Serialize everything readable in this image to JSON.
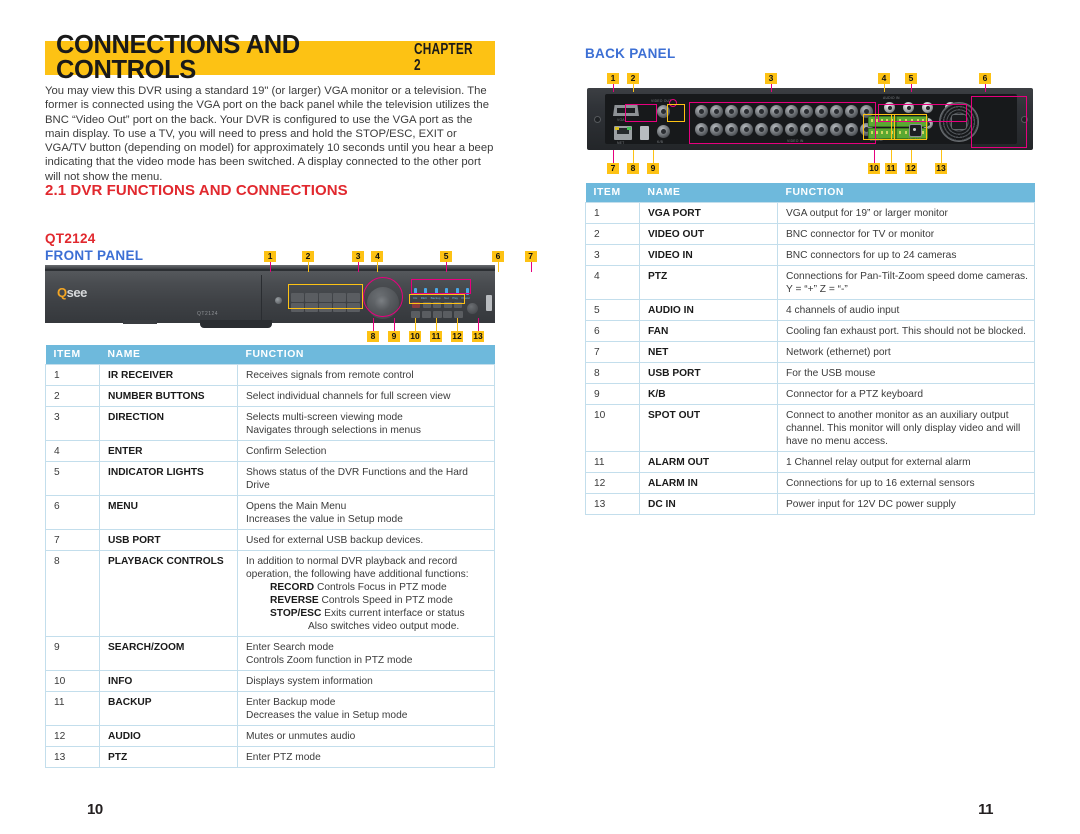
{
  "banner": {
    "title": "CONNECTIONS AND CONTROLS",
    "chapter": "CHAPTER 2"
  },
  "intro": {
    "paragraph": "You may view this DVR using a standard 19\" (or larger) VGA monitor or a television. The former is connected using the VGA port on the back panel while the television utilizes the BNC “Video Out” port on the back. Your DVR is configured to use the VGA port as the main display. To use a TV, you will need to press and hold the STOP/ESC, EXIT or VGA/TV button (depending on model) for approximately 10 seconds until you hear a beep indicating that the video mode has been switched. A display connected to the other port will not show the menu."
  },
  "headings": {
    "section": "2.1 DVR FUNCTIONS AND CONNECTIONS",
    "model": "QT2124",
    "front_panel": "FRONT PANEL",
    "back_panel": "BACK PANEL"
  },
  "device": {
    "front_logo_q": "Q",
    "front_logo_rest": "see",
    "front_model_label": "QT2124",
    "led_labels": [
      "CH",
      "REC",
      "Backup",
      "Net",
      "Play",
      "Power"
    ],
    "back_labels": {
      "video_out": "VIDEO OUT",
      "video_in": "VIDEO IN",
      "audio_in": "AUDIO IN",
      "net": "NET",
      "kb": "K/B",
      "alarm": "ALARM",
      "dc": "DC 12V"
    }
  },
  "callouts": {
    "front_top": [
      "1",
      "2",
      "3",
      "4",
      "5",
      "6",
      "7"
    ],
    "front_bottom": [
      "8",
      "9",
      "10",
      "11",
      "12",
      "13"
    ],
    "back_top": [
      "1",
      "2",
      "3",
      "4",
      "5",
      "6"
    ],
    "back_bottom": [
      "7",
      "8",
      "9",
      "10",
      "11",
      "12",
      "13"
    ]
  },
  "table_headers": {
    "item": "ITEM",
    "name": "NAME",
    "function": "FUNCTION"
  },
  "front_panel_table": [
    {
      "item": "1",
      "name": "IR RECEIVER",
      "lines": [
        {
          "t": "Receives signals from remote control"
        }
      ]
    },
    {
      "item": "2",
      "name": "NUMBER BUTTONS",
      "lines": [
        {
          "t": "Select individual channels for full screen view"
        }
      ]
    },
    {
      "item": "3",
      "name": "DIRECTION",
      "lines": [
        {
          "t": "Selects multi-screen viewing mode"
        },
        {
          "t": "Navigates through selections in menus"
        }
      ]
    },
    {
      "item": "4",
      "name": "ENTER",
      "lines": [
        {
          "t": "Confirm Selection"
        }
      ]
    },
    {
      "item": "5",
      "name": "INDICATOR LIGHTS",
      "lines": [
        {
          "t": "Shows status of the DVR Functions and the Hard Drive"
        }
      ]
    },
    {
      "item": "6",
      "name": "MENU",
      "lines": [
        {
          "t": "Opens the Main Menu"
        },
        {
          "t": "Increases the value in Setup mode"
        }
      ]
    },
    {
      "item": "7",
      "name": "USB PORT",
      "lines": [
        {
          "t": "Used for external USB backup devices."
        }
      ]
    },
    {
      "item": "8",
      "name": "PLAYBACK CONTROLS",
      "lines": [
        {
          "t": "In addition to normal DVR playback and record operation, the following have additional functions:"
        },
        {
          "b": "RECORD",
          "t": " Controls Focus in PTZ mode",
          "indent": 1
        },
        {
          "b": "REVERSE",
          "t": " Controls Speed in PTZ mode",
          "indent": 1
        },
        {
          "b": "STOP/ESC",
          "t": " Exits current interface or status",
          "indent": 1
        },
        {
          "t": "Also switches video output mode.",
          "indent": 2
        }
      ]
    },
    {
      "item": "9",
      "name": "SEARCH/ZOOM",
      "lines": [
        {
          "t": "Enter Search mode"
        },
        {
          "t": "Controls Zoom function in PTZ mode"
        }
      ]
    },
    {
      "item": "10",
      "name": "INFO",
      "lines": [
        {
          "t": "Displays system information"
        }
      ]
    },
    {
      "item": "11",
      "name": "BACKUP",
      "lines": [
        {
          "t": "Enter Backup mode"
        },
        {
          "t": "Decreases the value in Setup mode"
        }
      ]
    },
    {
      "item": "12",
      "name": "AUDIO",
      "lines": [
        {
          "t": "Mutes or unmutes audio"
        }
      ]
    },
    {
      "item": "13",
      "name": "PTZ",
      "lines": [
        {
          "t": "Enter PTZ mode"
        }
      ]
    }
  ],
  "back_panel_table": [
    {
      "item": "1",
      "name": "VGA PORT",
      "lines": [
        {
          "t": "VGA output for 19” or larger monitor"
        }
      ]
    },
    {
      "item": "2",
      "name": "VIDEO OUT",
      "lines": [
        {
          "t": "BNC connector for TV or monitor"
        }
      ]
    },
    {
      "item": "3",
      "name": "VIDEO IN",
      "lines": [
        {
          "t": "BNC connectors for up to 24 cameras"
        }
      ]
    },
    {
      "item": "4",
      "name": "PTZ",
      "lines": [
        {
          "t": "Connections for Pan-Tilt-Zoom speed dome cameras."
        },
        {
          "t": "Y = “+”  Z = “-”"
        }
      ]
    },
    {
      "item": "5",
      "name": "AUDIO IN",
      "lines": [
        {
          "t": "4 channels of audio input"
        }
      ]
    },
    {
      "item": "6",
      "name": "FAN",
      "lines": [
        {
          "t": "Cooling fan exhaust port. This should not be blocked."
        }
      ]
    },
    {
      "item": "7",
      "name": "NET",
      "lines": [
        {
          "t": "Network (ethernet) port"
        }
      ]
    },
    {
      "item": "8",
      "name": "USB PORT",
      "lines": [
        {
          "t": "For the USB mouse"
        }
      ]
    },
    {
      "item": "9",
      "name": "K/B",
      "lines": [
        {
          "t": "Connector for a PTZ keyboard"
        }
      ]
    },
    {
      "item": "10",
      "name": "SPOT OUT",
      "lines": [
        {
          "t": "Connect to another monitor as an auxiliary output channel. This monitor will only display video and will have no menu access."
        }
      ]
    },
    {
      "item": "11",
      "name": "ALARM OUT",
      "lines": [
        {
          "t": "1 Channel relay output for external alarm"
        }
      ]
    },
    {
      "item": "12",
      "name": "ALARM IN",
      "lines": [
        {
          "t": "Connections for up to 16 external sensors"
        }
      ]
    },
    {
      "item": "13",
      "name": "DC IN",
      "lines": [
        {
          "t": "Power input for 12V DC power supply"
        }
      ]
    }
  ],
  "page_numbers": {
    "left": "10",
    "right": "11"
  },
  "colors": {
    "banner": "#FDC214",
    "heading_red": "#E1282E",
    "heading_blue": "#3C6FD4",
    "table_header": "#6EB9DC",
    "table_border": "#C3DEEC",
    "callout_chip": "#FDC214",
    "highlight_magenta": "#E6007E",
    "highlight_yellow": "#FDC214"
  }
}
